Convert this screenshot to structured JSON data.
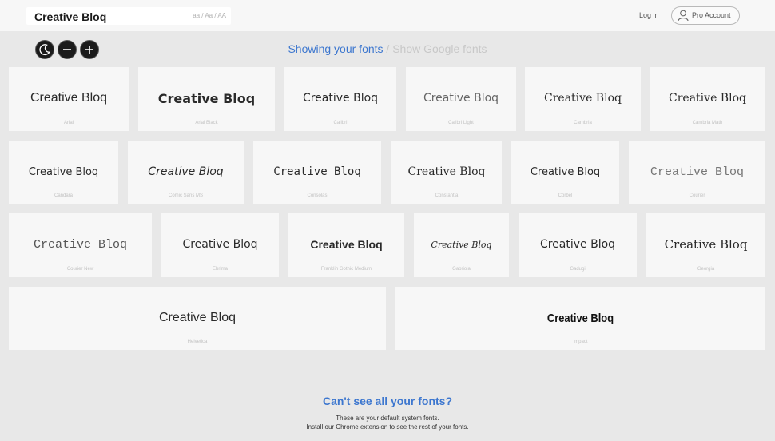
{
  "header": {
    "preview_text": "Creative Bloq",
    "case_toggle": "aa / Aa / AA",
    "login_label": "Log in",
    "pro_account_label": "Pro Account"
  },
  "controls": {
    "dark_mode_icon": "moon-icon",
    "decrease_icon": "minus-icon",
    "increase_icon": "plus-icon"
  },
  "source_toggle": {
    "active": "Showing your fonts",
    "separator": " / ",
    "inactive": "Show Google fonts"
  },
  "colors": {
    "accent": "#3d77cf",
    "background": "#e8e8e8",
    "card": "#f7f7f7"
  },
  "fonts": [
    {
      "sample": "Creative Bloq",
      "name": "Arial"
    },
    {
      "sample": "Creative Bloq",
      "name": "Arial Black"
    },
    {
      "sample": "Creative Bloq",
      "name": "Calibri"
    },
    {
      "sample": "Creative Bloq",
      "name": "Calibri Light"
    },
    {
      "sample": "Creative Bloq",
      "name": "Cambria"
    },
    {
      "sample": "Creative Bloq",
      "name": "Cambria Math"
    },
    {
      "sample": "Creative Bloq",
      "name": "Candara"
    },
    {
      "sample": "Creative Bloq",
      "name": "Comic Sans MS"
    },
    {
      "sample": "Creative Bloq",
      "name": "Consolas"
    },
    {
      "sample": "Creative Bloq",
      "name": "Constantia"
    },
    {
      "sample": "Creative Bloq",
      "name": "Corbel"
    },
    {
      "sample": "Creative Bloq",
      "name": "Courier"
    },
    {
      "sample": "Creative Bloq",
      "name": "Courier New"
    },
    {
      "sample": "Creative Bloq",
      "name": "Ebrima"
    },
    {
      "sample": "Creative Bloq",
      "name": "Franklin Gothic Medium"
    },
    {
      "sample": "Creative Bloq",
      "name": "Gabriola"
    },
    {
      "sample": "Creative Bloq",
      "name": "Gadugi"
    },
    {
      "sample": "Creative Bloq",
      "name": "Georgia"
    },
    {
      "sample": "Creative Bloq",
      "name": "Helvetica"
    },
    {
      "sample": "Creative Bloq",
      "name": "Impact"
    }
  ],
  "help": {
    "title": "Can't see all your fonts?",
    "line1": "These are your default system fonts.",
    "line2": "Install our Chrome extension to see the rest of your fonts."
  }
}
